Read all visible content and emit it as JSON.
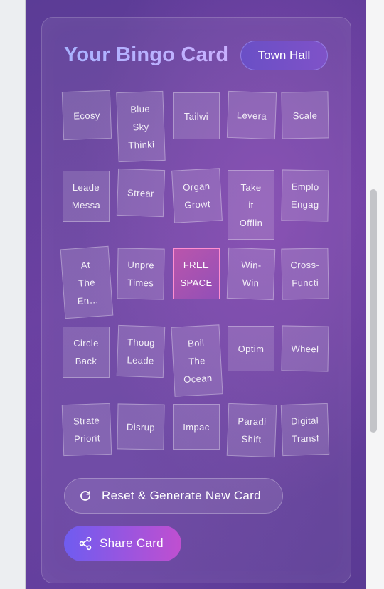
{
  "title": "Your Bingo Card",
  "badge": "Town Hall",
  "tiles": [
    "Ecosy",
    "Blue\nSky\nThinki",
    "Tailwi",
    "Levera",
    "Scale",
    "Leade\nMessa",
    "Strear",
    "Organ\nGrowt",
    "Take\nit\nOfflin",
    "Emplo\nEngag",
    "At\nThe\nEn…",
    "Unpre\nTimes",
    "FREE\nSPACE",
    "Win-\nWin",
    "Cross-\nFuncti",
    "Circle\nBack",
    "Thoug\nLeade",
    "Boil\nThe\nOcean",
    "Optim",
    "Wheel",
    "Strate\nPriorit",
    "Disrup",
    "Impac",
    "Paradi\nShift",
    "Digital\nTransf"
  ],
  "actions": {
    "reset_label": "Reset & Generate New Card",
    "share_label": "Share Card"
  },
  "icons": {
    "reset": "refresh-icon",
    "share": "share-icon"
  },
  "colors": {
    "free_space_accent": "#ff8fd0",
    "share_gradient_start": "#6f5cf0",
    "share_gradient_end": "#c04fd0"
  }
}
